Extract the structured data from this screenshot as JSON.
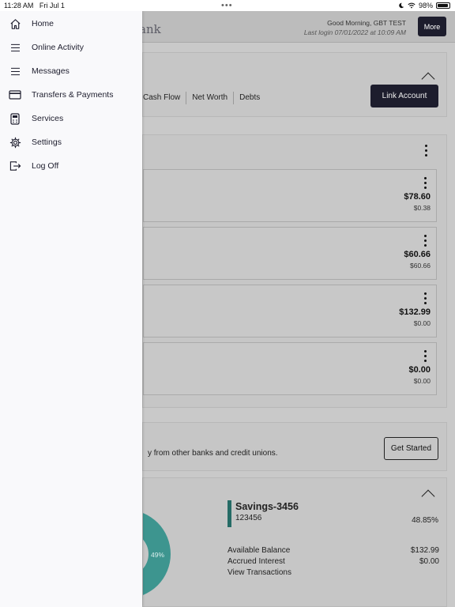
{
  "status_bar": {
    "time": "11:28 AM",
    "date": "Fri Jul 1",
    "battery": "98%",
    "icons": [
      "moon-icon",
      "wifi-icon",
      "battery-icon"
    ]
  },
  "drawer": {
    "items": [
      {
        "label": "Home",
        "icon": "home-icon"
      },
      {
        "label": "Online Activity",
        "icon": "menu-lines-icon"
      },
      {
        "label": "Messages",
        "icon": "menu-lines-icon"
      },
      {
        "label": "Transfers & Payments",
        "icon": "credit-card-icon"
      },
      {
        "label": "Services",
        "icon": "calculator-icon"
      },
      {
        "label": "Settings",
        "icon": "gear-icon"
      },
      {
        "label": "Log Off",
        "icon": "logout-icon"
      }
    ]
  },
  "header": {
    "logo_fragment": "ank",
    "greeting": "Good Morning, GBT TEST",
    "last_login": "Last login 07/01/2022 at 10:09 AM",
    "more_label": "More"
  },
  "overview": {
    "tabs": [
      "Cash Flow",
      "Net Worth",
      "Debts"
    ],
    "link_account_label": "Link Account"
  },
  "accounts": [
    {
      "amount": "$78.60",
      "sub": "$0.38"
    },
    {
      "amount": "$60.66",
      "sub": "$60.66"
    },
    {
      "amount": "$132.99",
      "sub": "$0.00"
    },
    {
      "amount": "$0.00",
      "sub": "$0.00"
    }
  ],
  "external": {
    "text": "y from other banks and credit unions.",
    "button_label": "Get Started"
  },
  "savings": {
    "name": "Savings-3456",
    "number": "123456",
    "percent": "48.85%",
    "donut_label": "49%",
    "rows": [
      {
        "label": "Available Balance",
        "value": "$132.99"
      },
      {
        "label": "Accrued Interest",
        "value": "$0.00"
      },
      {
        "label": "View Transactions",
        "value": ""
      }
    ],
    "colors": {
      "accent": "#256b66",
      "donut": "#2e8f88"
    }
  }
}
